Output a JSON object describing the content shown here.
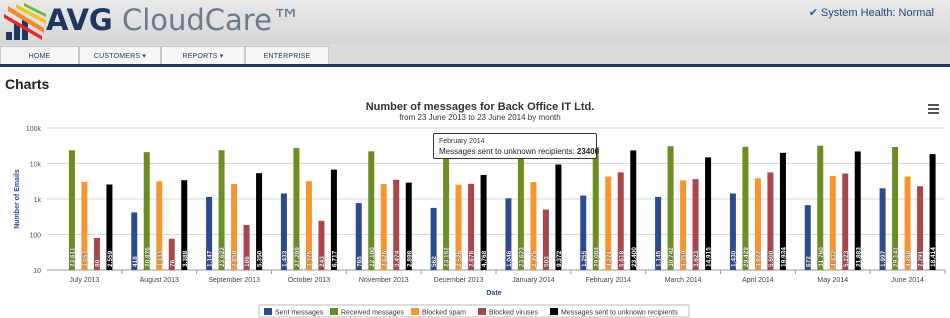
{
  "brand": {
    "name_bold": "AVG",
    "name_rest": "CloudCare™"
  },
  "system_health": {
    "label": "System Health: Normal"
  },
  "nav": {
    "items": [
      {
        "label": "HOME"
      },
      {
        "label": "CUSTOMERS ▾"
      },
      {
        "label": "REPORTS ▾"
      },
      {
        "label": "ENTERPRISE"
      }
    ]
  },
  "page": {
    "title": "Charts"
  },
  "tooltip": {
    "date": "February 2014",
    "series_label": "Messages sent to unknown recipients:",
    "value": "23400"
  },
  "colors": {
    "sent": "#2a4b8d",
    "received": "#6b8e23",
    "spam": "#f7962e",
    "viruses": "#a8464b",
    "unknown": "#000000"
  },
  "chart_data": {
    "type": "bar",
    "title": "Number of messages for Back Office IT Ltd.",
    "subtitle": "from 23 June 2013 to 23 June 2014 by month",
    "xlabel": "Date",
    "ylabel": "Number of Emails",
    "yscale": "log",
    "ylim": [
      10,
      100000
    ],
    "yticks": [
      "10",
      "100",
      "1k",
      "10k",
      "100k"
    ],
    "legend_position": "bottom",
    "categories": [
      "July 2013",
      "August 2013",
      "September 2013",
      "October 2013",
      "November 2013",
      "December 2013",
      "January 2014",
      "February 2014",
      "March 2014",
      "April 2014",
      "May 2014",
      "June 2014"
    ],
    "series": [
      {
        "name": "Sent messages",
        "values": [
          null,
          418,
          1147,
          1433,
          765,
          562,
          1046,
          1255,
          1145,
          1430,
          672,
          1997
        ],
        "labels": [
          "",
          "418",
          "1,147",
          "1,433",
          "765",
          "562",
          "1,046",
          "1,255",
          "1,145",
          "1,430",
          "672",
          "1,997"
        ]
      },
      {
        "name": "Received messages",
        "values": [
          23611,
          20876,
          23622,
          27209,
          22100,
          23152,
          23623,
          29004,
          30742,
          29429,
          31760,
          29141
        ],
        "labels": [
          "23,611",
          "20,876",
          "23,622",
          "27,209",
          "22,100",
          "23,152",
          "23,623",
          "29,004",
          "30,742",
          "29,429",
          "31,760",
          "29,141"
        ]
      },
      {
        "name": "Blocked spam",
        "values": [
          3057,
          3133,
          2650,
          3175,
          2626,
          2526,
          2975,
          4271,
          3359,
          3822,
          4432,
          4268
        ],
        "labels": [
          "3,057",
          "3,133",
          "2,650",
          "3,175",
          "2,626",
          "2,526",
          "2,975",
          "4,271",
          "3,359",
          "3,822",
          "4,432",
          "4,268"
        ]
      },
      {
        "name": "Blocked viruses",
        "values": [
          80,
          76,
          186,
          243,
          3474,
          2678,
          503,
          5618,
          3623,
          5600,
          5223,
          2291
        ],
        "labels": [
          "80",
          "76",
          "186",
          "243",
          "3,474",
          "2,678",
          "503",
          "5,618",
          "3,623",
          "5,600",
          "5,223",
          "2,291"
        ]
      },
      {
        "name": "Messages sent to unknown recipients",
        "values": [
          2559,
          3388,
          5350,
          6717,
          2898,
          4768,
          9372,
          23400,
          14915,
          19934,
          21883,
          18414
        ],
        "labels": [
          "2,559",
          "3,388",
          "5,350",
          "6,717",
          "2,898",
          "4,768",
          "9,372",
          "23,400",
          "14,915",
          "19,934",
          "21,883",
          "18,414"
        ]
      }
    ]
  }
}
